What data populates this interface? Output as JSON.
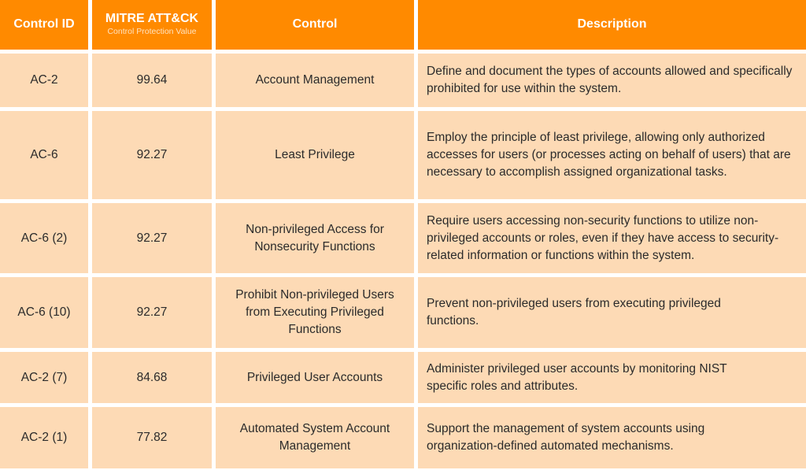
{
  "header": {
    "col_control_id": "Control ID",
    "col_mitre_title": "MITRE ATT&CK",
    "col_mitre_subtitle": "Control Protection Value",
    "col_control": "Control",
    "col_description": "Description"
  },
  "colors": {
    "header_bg": "#ff8a00",
    "header_text": "#ffffff",
    "cell_bg": "#fddab5",
    "cell_text": "#2b2b2b",
    "gutter": "#ffffff"
  },
  "rows": [
    {
      "id": "AC-2",
      "value": "99.64",
      "control": "Account Management",
      "description": "Define and document the types of accounts allowed and specifically prohibited for use within the system."
    },
    {
      "id": "AC-6",
      "value": "92.27",
      "control": "Least Privilege",
      "description": "Employ the principle of least privilege, allowing only authorized accesses for users (or processes acting on behalf of users) that are necessary to accomplish assigned organizational tasks."
    },
    {
      "id": "AC-6 (2)",
      "value": "92.27",
      "control": "Non-privileged Access for Nonsecurity Functions",
      "description": "Require users accessing non-security functions to utilize non-privileged accounts or roles, even if they have access to security-related information or functions within the system."
    },
    {
      "id": "AC-6 (10)",
      "value": "92.27",
      "control": "Prohibit Non-privileged Users from Executing Privileged Functions",
      "description": "Prevent non-privileged users from executing privileged functions."
    },
    {
      "id": "AC-2 (7)",
      "value": "84.68",
      "control": "Privileged User Accounts",
      "description": "Administer privileged user accounts by monitoring NIST specific roles and attributes."
    },
    {
      "id": "AC-2 (1)",
      "value": "77.82",
      "control": "Automated System Account Management",
      "description": "Support the management of system accounts using organization-defined automated mechanisms."
    }
  ]
}
